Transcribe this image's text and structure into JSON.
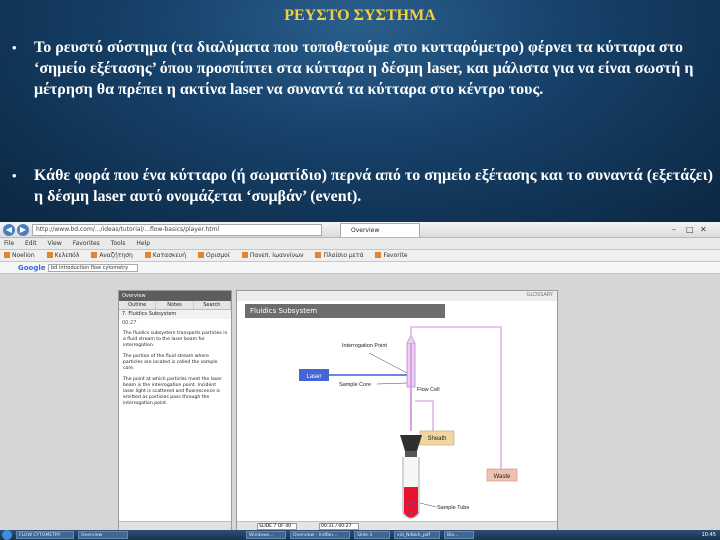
{
  "slide": {
    "title": "ΡΕΥΣΤΟ ΣΥΣΤΗΜΑ",
    "title_color": "#f4d03f",
    "bullet_char": "•",
    "bullet1": "Το ρευστό σύστημα (τα διαλύματα που τοποθετούμε στο κυτταρόμετρο) φέρνει τα κύτταρα στο ‘σημείο εξέτασης’ όπου προσπίπτει στα κύτταρα η δέσμη laser, και μάλιστα για να είναι σωστή η μέτρηση θα πρέπει η ακτίνα laser να συναντά τα κύτταρα στο κέντρο τους.",
    "bullet2": "Κάθε φορά που ένα κύτταρο (ή σωματίδιο) περνά από το σημείο εξέτασης και το συναντά (εξετάζει) η δέσμη laser αυτό ονομάζεται ‘συμβάν’ (event)."
  },
  "browser": {
    "address": "http://www.bd.com/.../ideas/tutorial/...flow-basics/player.html",
    "tab_label": "Overview",
    "menu": [
      "File",
      "Edit",
      "View",
      "Favorites",
      "Tools",
      "Help"
    ],
    "favorites": [
      "Noelion",
      "Κελεπόλ",
      "Αναζήτηση",
      "Κατασκευή",
      "Ορισμοί",
      "Πανεπ. Ιωαννίνων",
      "Πλαίσιο μετά",
      "Favorite"
    ],
    "google_label": "Google",
    "google_search": "bd introduction flow cytometry"
  },
  "player": {
    "left_header": "Overview",
    "tabs": [
      "Outline",
      "Notes",
      "Search"
    ],
    "current_item": "7. Fluidics Subsystem",
    "time": "00:27",
    "paragraphs": [
      "The fluidics subsystem transports particles in a fluid stream to the laser beam for interrogation.",
      "The portion of the fluid stream where particles are located is called the sample core.",
      "The point at which particles meet the laser beam is the interrogation point. Incident laser light is scattered and fluorescence is emitted as particles pass through the interrogation point."
    ],
    "slide_title": "Fluidics Subsystem",
    "glossary": "GLOSSARY",
    "slide_counter": "SLIDE 7 OF 40",
    "time_counter": "00:31 / 00:27"
  },
  "diagram": {
    "labels": {
      "laser": "Laser",
      "interrogation": "Interrogation Point",
      "sample_core": "Sample Core",
      "flow_cell": "Flow Cell",
      "sheath": "Sheath",
      "waste": "Waste",
      "sample_tube": "Sample Tube"
    },
    "colors": {
      "laser": "#4466d4",
      "sheath_fill": "#f2d6a2",
      "waste_fill": "#f2c0b0",
      "sample": "#e8132f",
      "tube_line": "#d7a0e0"
    }
  },
  "taskbar": {
    "items": [
      "FLOW CYTOMETRY",
      "Overview",
      "Windows...",
      "Overview - Indfan...",
      "Slide-1",
      "vid_N4bkh_pdf",
      "Bio..."
    ],
    "clock": "10:45"
  }
}
